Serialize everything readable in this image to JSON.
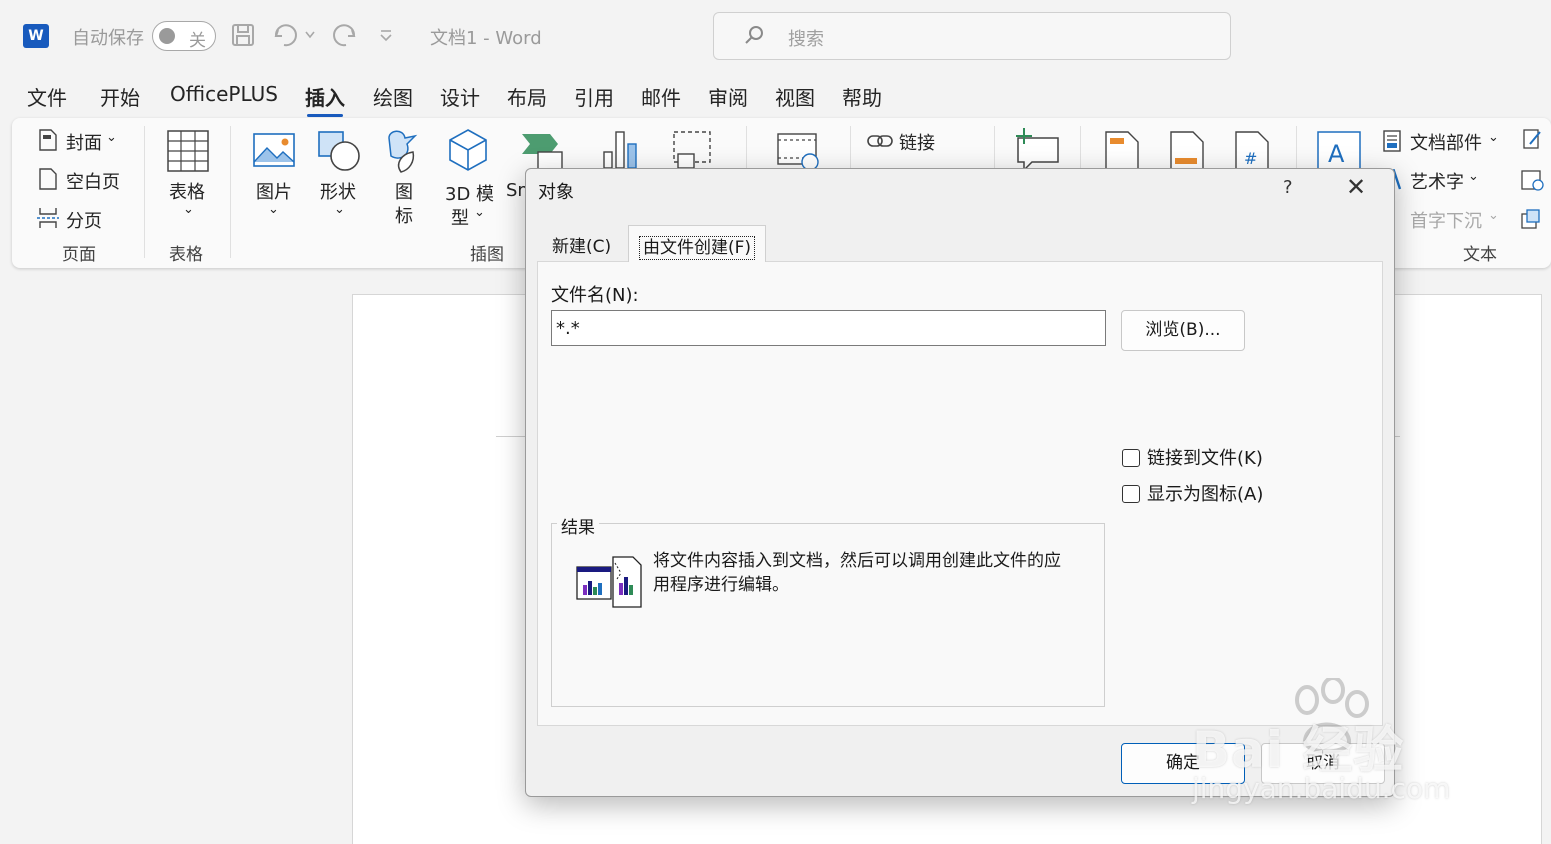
{
  "titlebar": {
    "app_logo": "W",
    "autosave_label": "自动保存",
    "autosave_toggle": "关",
    "doc_title": "文档1  -  Word",
    "search_placeholder": "搜索"
  },
  "menu": [
    "文件",
    "开始",
    "OfficePLUS",
    "插入",
    "绘图",
    "设计",
    "布局",
    "引用",
    "邮件",
    "审阅",
    "视图",
    "帮助"
  ],
  "active_menu": "插入",
  "ribbon": {
    "pages": {
      "cover": "封面",
      "blank": "空白页",
      "break": "分页",
      "group": "页面"
    },
    "tables": {
      "table": "表格",
      "group": "表格"
    },
    "illustrations": {
      "picture": "图片",
      "shapes": "形状",
      "icons_1": "图",
      "icons_2": "标",
      "model_1": "3D 模",
      "model_2": "型",
      "smartart": "Sm",
      "group": "插图"
    },
    "links": {
      "link": "链接"
    },
    "text": {
      "doc_parts": "文档部件",
      "wordart": "艺术字",
      "dropcap": "首字下沉",
      "group": "文本"
    }
  },
  "dialog": {
    "title": "对象",
    "help": "?",
    "close": "✕",
    "tab_new": "新建(C)",
    "tab_from_file": "由文件创建(F)",
    "filename_label": "文件名(N):",
    "filename_value": "*.*",
    "browse_button": "浏览(B)...",
    "link_checkbox": "链接到文件(K)",
    "icon_checkbox": "显示为图标(A)",
    "result_label": "结果",
    "result_text": "将文件内容插入到文档，然后可以调用创建此文件的应用程序进行编辑。",
    "ok_button": "确定",
    "cancel_button": "取消"
  },
  "watermark": {
    "line1": "Bai  经验",
    "line2": "jingyan.baidu.com"
  },
  "colors": {
    "accent": "#185abd",
    "ribbon_bg": "#fafafa",
    "dialog_bg": "#f0f0f0",
    "icon_blue": "#1f6fbf",
    "icon_orange": "#e88b2e",
    "icon_green": "#2e8b57"
  }
}
